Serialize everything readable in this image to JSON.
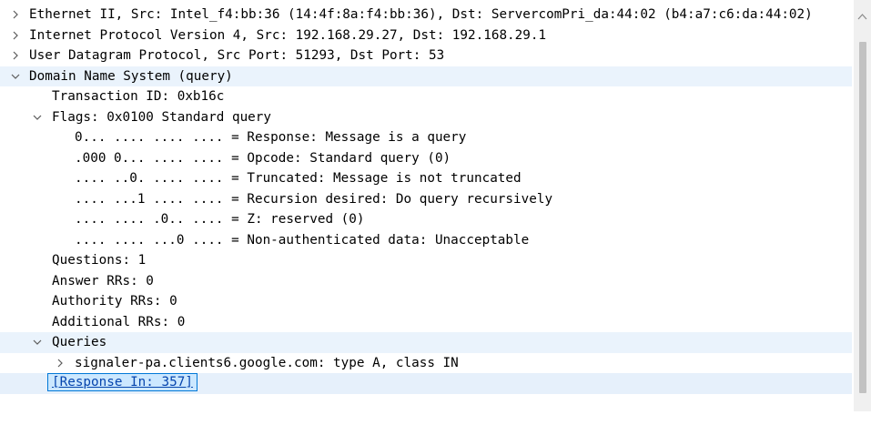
{
  "tree": {
    "rows": [
      {
        "text": "Ethernet II, Src: Intel_f4:bb:36 (14:4f:8a:f4:bb:36), Dst: ServercomPri_da:44:02 (b4:a7:c6:da:44:02)",
        "expanded": false
      },
      {
        "text": "Internet Protocol Version 4, Src: 192.168.29.27, Dst: 192.168.29.1",
        "expanded": false
      },
      {
        "text": "User Datagram Protocol, Src Port: 51293, Dst Port: 53",
        "expanded": false
      },
      {
        "text": "Domain Name System (query)",
        "expanded": true
      },
      {
        "text": "Transaction ID: 0xb16c"
      },
      {
        "text": "Flags: 0x0100 Standard query",
        "expanded": true
      },
      {
        "text": "0... .... .... .... = Response: Message is a query"
      },
      {
        "text": ".000 0... .... .... = Opcode: Standard query (0)"
      },
      {
        "text": ".... ..0. .... .... = Truncated: Message is not truncated"
      },
      {
        "text": ".... ...1 .... .... = Recursion desired: Do query recursively"
      },
      {
        "text": ".... .... .0.. .... = Z: reserved (0)"
      },
      {
        "text": ".... .... ...0 .... = Non-authenticated data: Unacceptable"
      },
      {
        "text": "Questions: 1"
      },
      {
        "text": "Answer RRs: 0"
      },
      {
        "text": "Authority RRs: 0"
      },
      {
        "text": "Additional RRs: 0"
      },
      {
        "text": "Queries",
        "expanded": true
      },
      {
        "text": "signaler-pa.clients6.google.com: type A, class IN",
        "expanded": false
      },
      {
        "text": "[Response In: 357]",
        "selected": true
      }
    ]
  },
  "colors": {
    "highlight_band": "#eaf3fc",
    "selection_bg": "#cce8ff",
    "selection_border": "#0078d7",
    "link": "#0645ad",
    "expander": "#5a5a5a"
  },
  "icons": {
    "collapsed": "chevron-right-icon",
    "expanded": "chevron-down-icon"
  }
}
